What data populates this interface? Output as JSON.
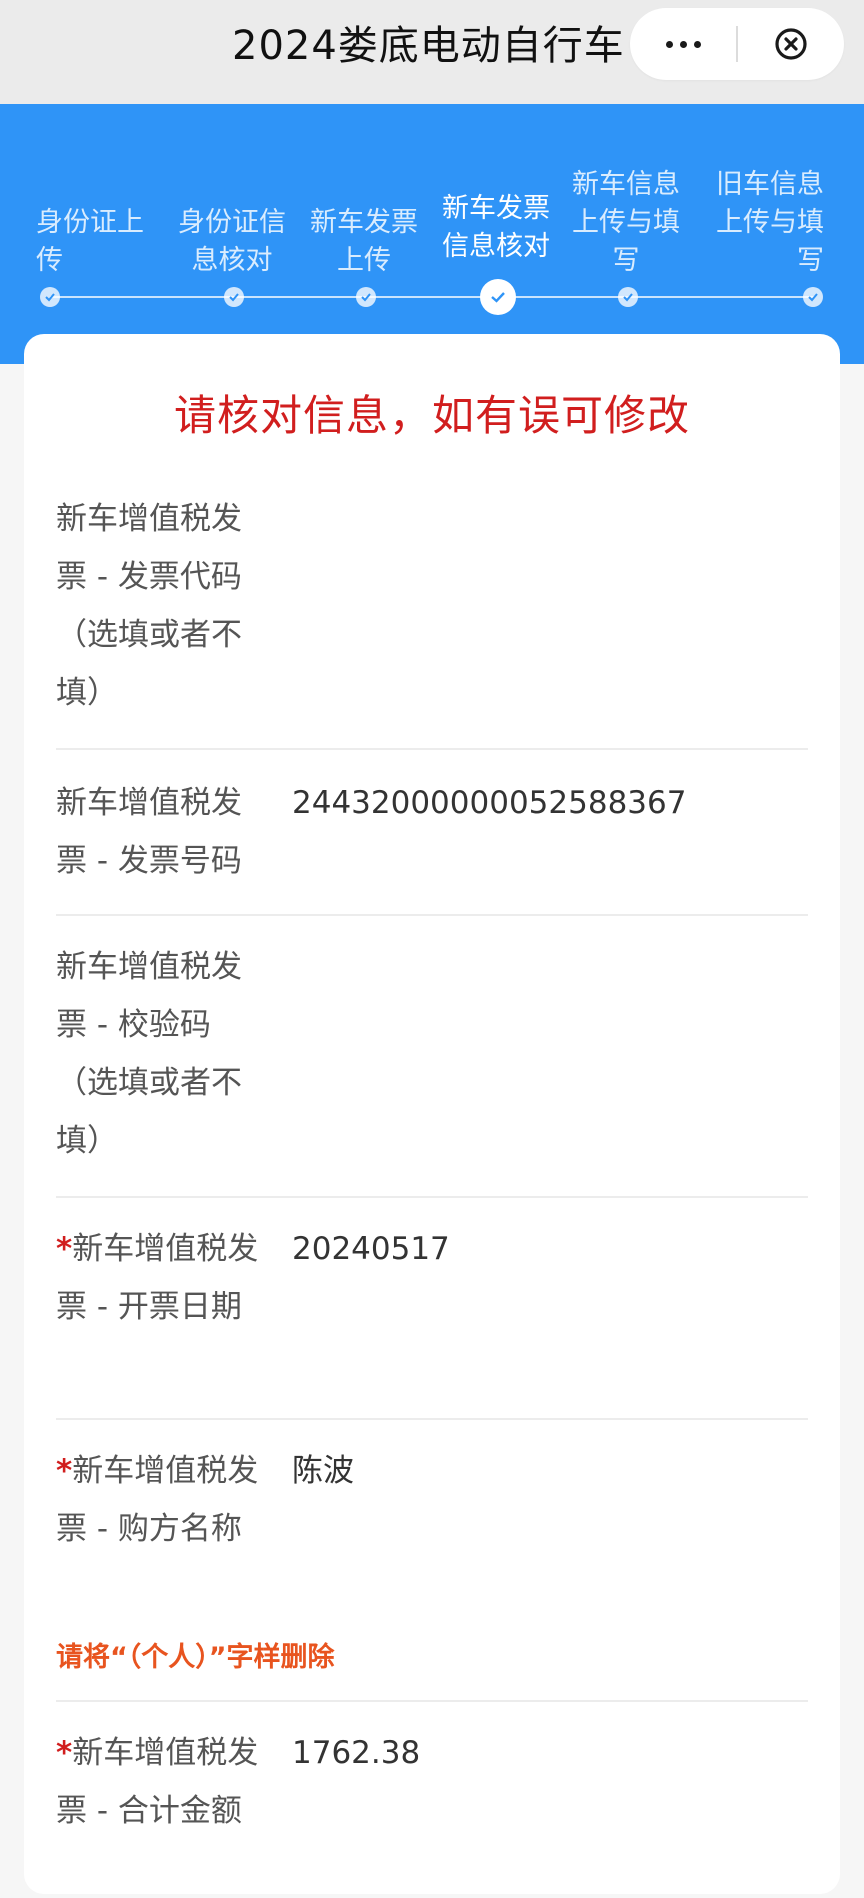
{
  "header": {
    "title": "2024娄底电动自行车",
    "more_icon": "more-dots-icon",
    "close_icon": "close-circle-icon"
  },
  "steps": [
    {
      "label": "身份证上传",
      "status": "done"
    },
    {
      "label": "身份证信息核对",
      "status": "done"
    },
    {
      "label": "新车发票上传",
      "status": "done"
    },
    {
      "label": "新车发票信息核对",
      "status": "current"
    },
    {
      "label": "新车信息上传与填写",
      "status": "pending"
    },
    {
      "label": "旧车信息上传与填写",
      "status": "pending"
    }
  ],
  "form": {
    "notice": "请核对信息，如有误可修改",
    "fields": [
      {
        "required": false,
        "label": "新车增值税发票 - 发票代码（选填或者不填）",
        "value": ""
      },
      {
        "required": false,
        "label": "新车增值税发票 - 发票号码",
        "value": "24432000000052588367"
      },
      {
        "required": false,
        "label": "新车增值税发票 - 校验码（选填或者不填）",
        "value": ""
      },
      {
        "required": true,
        "label": "新车增值税发票 - 开票日期",
        "value": "20240517"
      },
      {
        "required": true,
        "label": "新车增值税发票 - 购方名称",
        "value": "陈波",
        "hint": "请将“（个人）”字样删除"
      },
      {
        "required": true,
        "label": "新车增值税发票 - 合计金额",
        "value": "1762.38"
      }
    ]
  },
  "colors": {
    "primary_blue": "#2f94f7",
    "notice_red": "#d11e1e",
    "hint_orange": "#e8541f"
  }
}
